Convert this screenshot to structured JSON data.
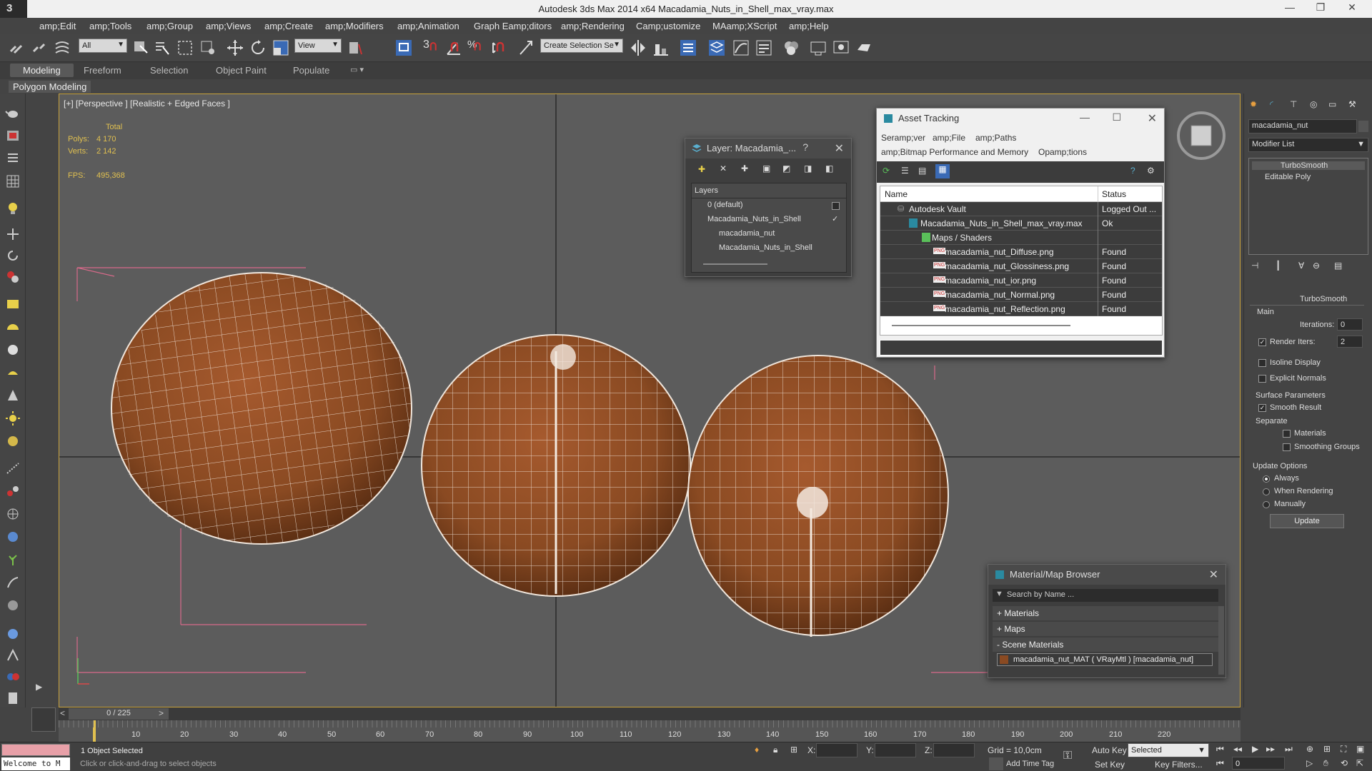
{
  "app": {
    "title": "Autodesk 3ds Max  2014 x64     Macadamia_Nuts_in_Shell_max_vray.max",
    "logo": "3"
  },
  "window_controls": {
    "minimize": "—",
    "restore": "❐",
    "close": "✕"
  },
  "menu": [
    "amp;Edit",
    "amp;Tools",
    "amp;Group",
    "amp;Views",
    "amp;Create",
    "amp;Modifiers",
    "amp;Animation",
    "Graph Eamp;ditors",
    "amp;Rendering",
    "Camp;ustomize",
    "MAamp;XScript",
    "amp;Help"
  ],
  "toolbar": {
    "filter_value": "All",
    "refcoord_value": "View",
    "selection_set_placeholder": "Create Selection Se",
    "snap_labels": [
      "3",
      "%"
    ]
  },
  "ribbon": {
    "tabs": [
      "Modeling",
      "Freeform",
      "Selection",
      "Object Paint",
      "Populate"
    ],
    "sub_label": "Polygon Modeling"
  },
  "viewport": {
    "label": "[+] [Perspective ] [Realistic + Edged Faces ]",
    "stats": {
      "total_label": "Total",
      "polys_label": "Polys:",
      "polys_value": "4 170",
      "verts_label": "Verts:",
      "verts_value": "2 142",
      "fps_label": "FPS:",
      "fps_value": "495,368"
    }
  },
  "layer_window": {
    "title": "Layer: Macadamia_...",
    "help": "?",
    "header": "Layers",
    "rows": [
      "0 (default)",
      "Macadamia_Nuts_in_Shell",
      "macadamia_nut",
      "Macadamia_Nuts_in_Shell"
    ],
    "active_check": "✓"
  },
  "asset_window": {
    "title": "Asset Tracking",
    "menu_row1": [
      "Seramp;ver",
      "amp;File",
      "amp;Paths"
    ],
    "menu_row2": [
      "amp;Bitmap Performance and Memory",
      "Opamp;tions"
    ],
    "col_name": "Name",
    "col_status": "Status",
    "rows": [
      {
        "name": "Autodesk Vault",
        "status": "Logged Out ..."
      },
      {
        "name": "Macadamia_Nuts_in_Shell_max_vray.max",
        "status": "Ok"
      },
      {
        "name": "Maps / Shaders",
        "status": ""
      },
      {
        "name": "macadamia_nut_Diffuse.png",
        "status": "Found"
      },
      {
        "name": "macadamia_nut_Glossiness.png",
        "status": "Found"
      },
      {
        "name": "macadamia_nut_ior.png",
        "status": "Found"
      },
      {
        "name": "macadamia_nut_Normal.png",
        "status": "Found"
      },
      {
        "name": "macadamia_nut_Reflection.png",
        "status": "Found"
      }
    ],
    "png_badge": "PNG"
  },
  "command_panel": {
    "object_name": "macadamia_nut",
    "modifier_list": "Modifier List",
    "stack": [
      "TurboSmooth",
      "Editable Poly"
    ],
    "rollout_title": "TurboSmooth",
    "main_label": "Main",
    "iterations_label": "Iterations:",
    "iterations_value": "0",
    "render_iters_label": "Render Iters:",
    "render_iters_value": "2",
    "isoline_label": "Isoline Display",
    "explicit_label": "Explicit Normals",
    "surface_label": "Surface Parameters",
    "smooth_result_label": "Smooth Result",
    "separate_label": "Separate",
    "materials_label": "Materials",
    "smoothing_label": "Smoothing Groups",
    "update_options_label": "Update Options",
    "always_label": "Always",
    "when_rendering_label": "When Rendering",
    "manually_label": "Manually",
    "update_button": "Update"
  },
  "material_browser": {
    "title": "Material/Map Browser",
    "search_placeholder": "Search by Name ...",
    "groups": [
      "+ Materials",
      "+ Maps",
      "- Scene Materials"
    ],
    "item": "macadamia_nut_MAT ( VRayMtl ) [macadamia_nut]"
  },
  "timeline": {
    "frame_label": "0 / 225",
    "prev": "<",
    "next": ">",
    "ticks": [
      "10",
      "20",
      "30",
      "40",
      "50",
      "60",
      "70",
      "80",
      "90",
      "100",
      "110",
      "120",
      "130",
      "140",
      "150",
      "160",
      "170",
      "180",
      "190",
      "200",
      "210",
      "220"
    ]
  },
  "status": {
    "listener": "Welcome to M",
    "selected": "1 Object Selected",
    "prompt": "Click or click-and-drag to select objects",
    "x_label": "X:",
    "y_label": "Y:",
    "z_label": "Z:",
    "grid": "Grid = 10,0cm",
    "autokey": "Auto Key",
    "setkey": "Set Key",
    "selected_dropdown": "Selected",
    "key_filters": "Key Filters...",
    "add_time_tag": "Add Time Tag",
    "frame_value": "0"
  },
  "colors": {
    "viewport_bg": "#5c5c5c",
    "active_border": "#c8a23c",
    "nut_brown": "#8a4a22",
    "stats_yellow": "#e0c050"
  }
}
